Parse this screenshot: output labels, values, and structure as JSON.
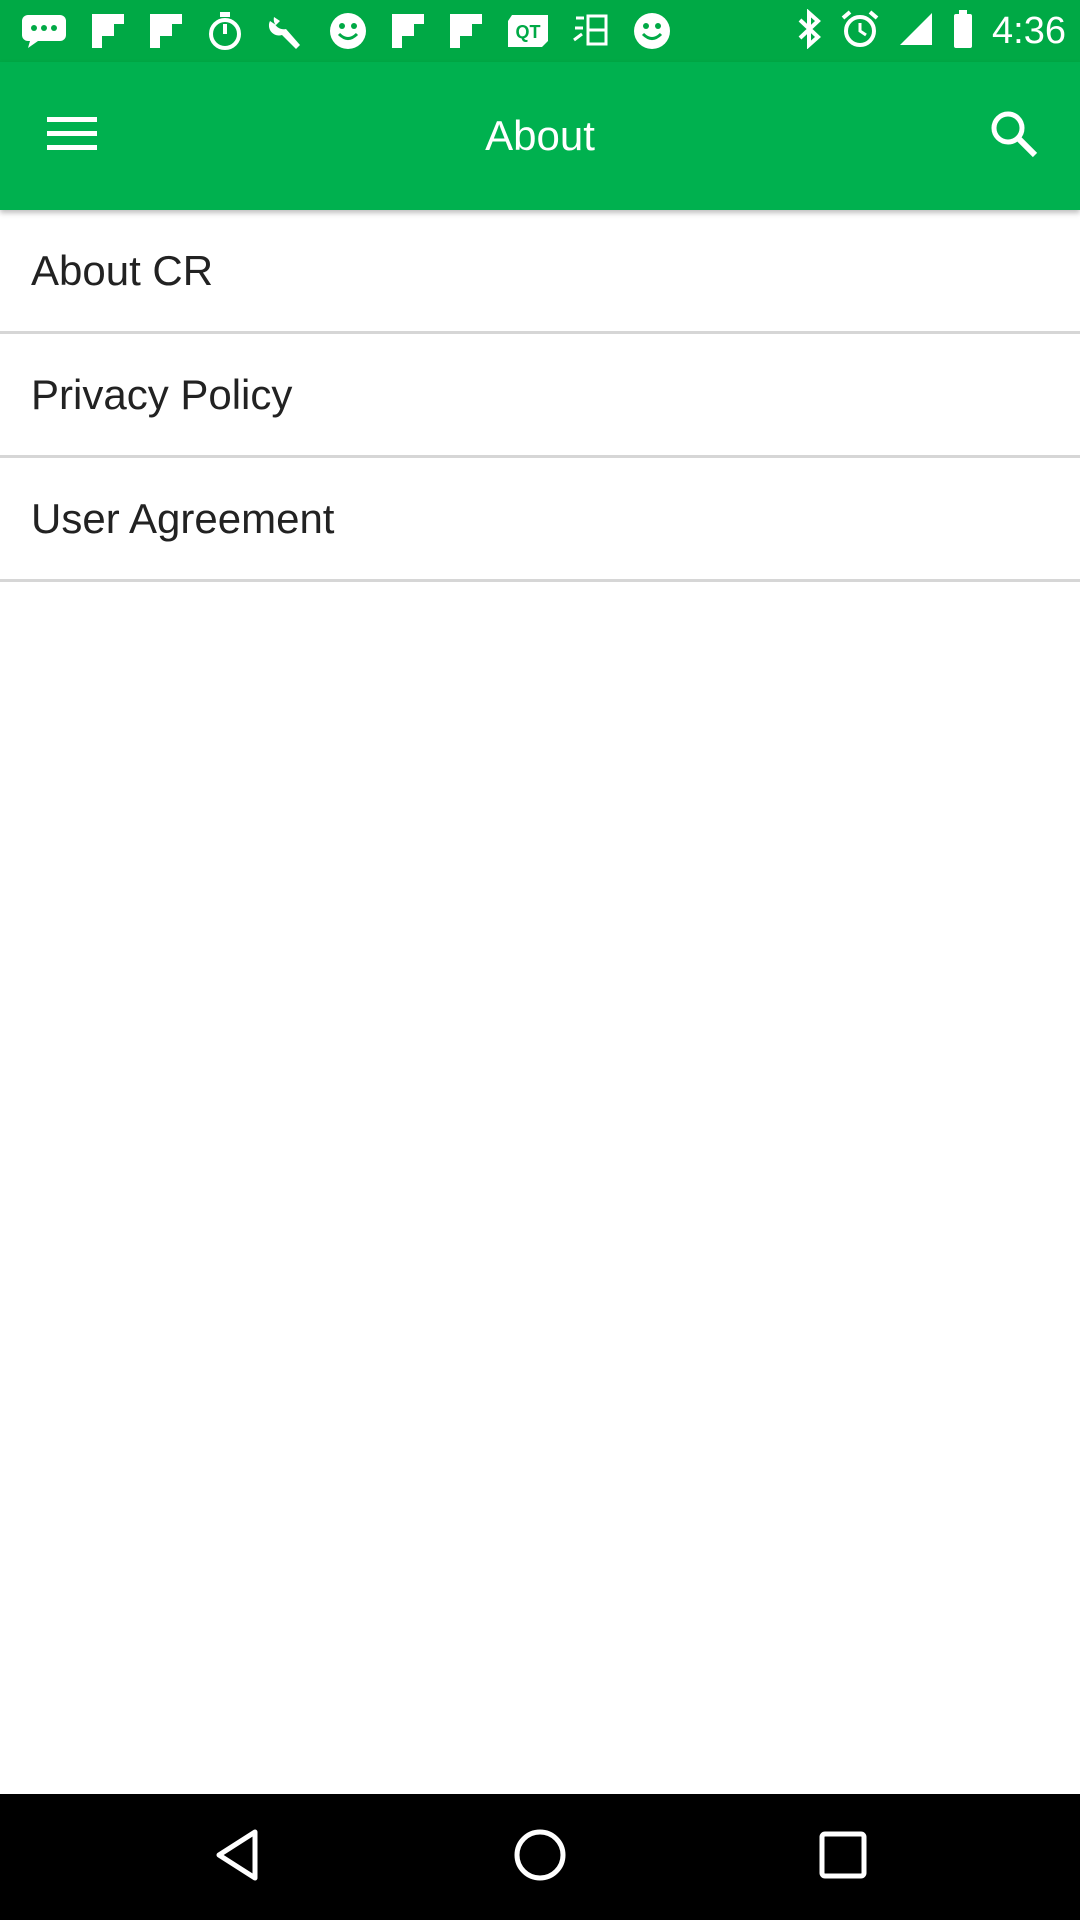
{
  "status_bar": {
    "time": "4:36",
    "icons": [
      "chat-bubble-icon",
      "flipboard-icon",
      "flipboard-icon",
      "stopwatch-icon",
      "wrench-icon",
      "smiley-icon",
      "flipboard-icon",
      "flipboard-icon",
      "qt-icon",
      "app-icon",
      "smiley-icon",
      "bluetooth-icon",
      "alarm-icon",
      "signal-icon",
      "battery-icon"
    ]
  },
  "app_bar": {
    "title": "About",
    "menu_icon": "menu-icon",
    "search_icon": "search-icon",
    "color": "#00b14f"
  },
  "list": {
    "items": [
      {
        "label": "About CR"
      },
      {
        "label": "Privacy Policy"
      },
      {
        "label": "User Agreement"
      }
    ]
  },
  "nav_bar": {
    "icons": [
      "back-icon",
      "home-icon",
      "recents-icon"
    ]
  }
}
